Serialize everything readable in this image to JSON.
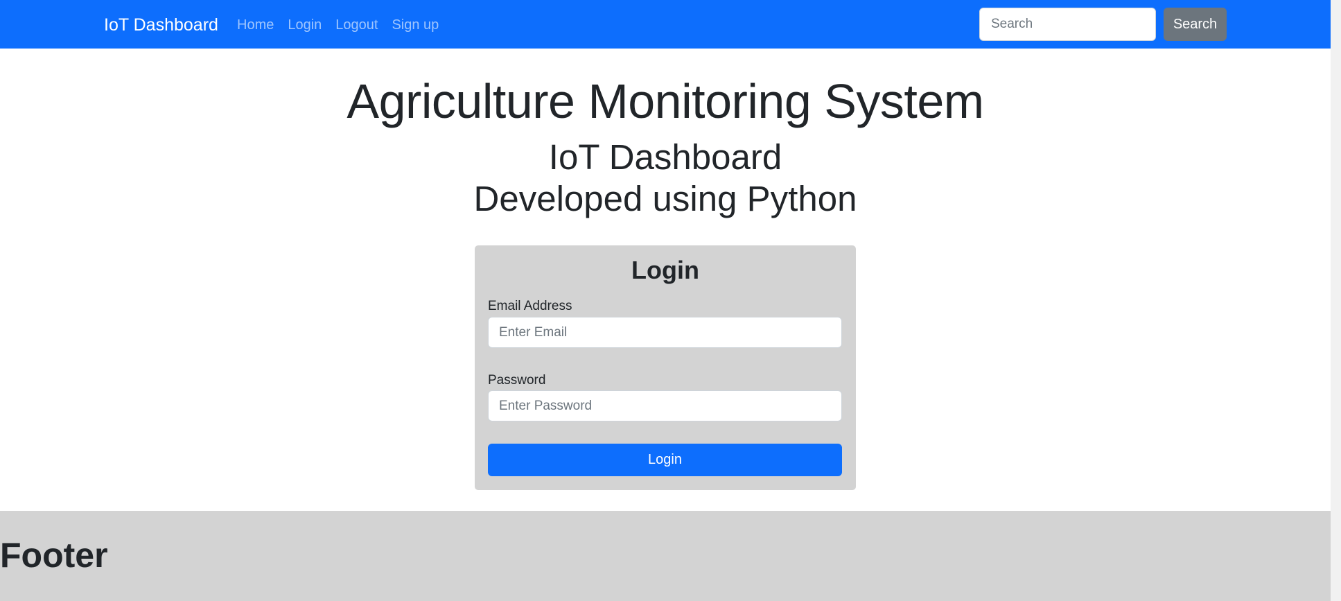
{
  "navbar": {
    "brand": "IoT Dashboard",
    "links": [
      "Home",
      "Login",
      "Logout",
      "Sign up"
    ],
    "search": {
      "placeholder": "Search",
      "value": "",
      "button_label": "Search"
    }
  },
  "hero": {
    "title": "Agriculture Monitoring System",
    "subtitle_line1": "IoT Dashboard",
    "subtitle_line2": "Developed using Python"
  },
  "login_form": {
    "title": "Login",
    "email_label": "Email Address",
    "email_placeholder": "Enter Email",
    "email_value": "",
    "password_label": "Password",
    "password_placeholder": "Enter Password",
    "password_value": "",
    "submit_label": "Login"
  },
  "footer": {
    "title": "Footer"
  },
  "colors": {
    "navbar_bg": "#0d6efd",
    "primary_button": "#0d6efd",
    "secondary_button": "#6c757d",
    "card_bg": "#d3d3d3",
    "footer_bg": "#d3d3d3"
  }
}
